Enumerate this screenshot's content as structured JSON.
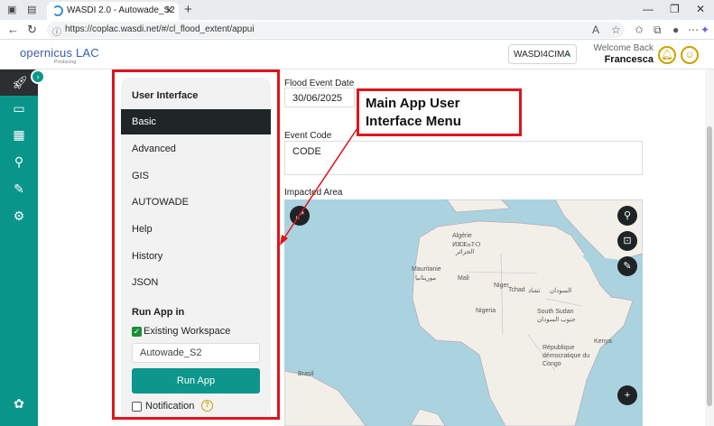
{
  "browser": {
    "tab_title": "WASDI 2.0 - Autowade_S2",
    "new_tab": "+",
    "url": "https://coplac.wasdi.net/#/cl_flood_extent/appui"
  },
  "header": {
    "logo_text": "opernicus LAC",
    "logo_sub": "Producing",
    "workspace": "WASDI4CIMA",
    "welcome": "Welcome Back",
    "user": "Francesca"
  },
  "menu": {
    "title": "User Interface",
    "items": [
      {
        "label": "Basic",
        "active": true
      },
      {
        "label": "Advanced"
      },
      {
        "label": "GIS"
      },
      {
        "label": "AUTOWADE"
      },
      {
        "label": "Help"
      },
      {
        "label": "History"
      },
      {
        "label": "JSON"
      }
    ],
    "run_title": "Run App in",
    "existing_workspace": "Existing Workspace",
    "workspace_value": "Autowade_S2",
    "run_button": "Run App",
    "notification": "Notification"
  },
  "form": {
    "date_label": "Flood Event Date",
    "date_value": "30/06/2025",
    "code_label": "Event Code",
    "code_value": "CODE",
    "area_label": "Impacted Area"
  },
  "map": {
    "labels": [
      "Algérie",
      "الجزائر",
      "ⵍⵣⵣⴰⵢⵔ",
      "Mauritanie",
      "موريتانيا",
      "Mali",
      "Niger",
      "Tchad",
      "تشاد",
      "السودان",
      "Nigeria",
      "South Sudan",
      "جنوب السودان",
      "République démocratique du Congo",
      "Kenya",
      "Brasil"
    ]
  },
  "annotation": {
    "line1": "Main App User",
    "line2": "Interface Menu"
  },
  "colors": {
    "accent": "#0a958a",
    "highlight": "#e0141c",
    "active_menu": "#202628"
  }
}
